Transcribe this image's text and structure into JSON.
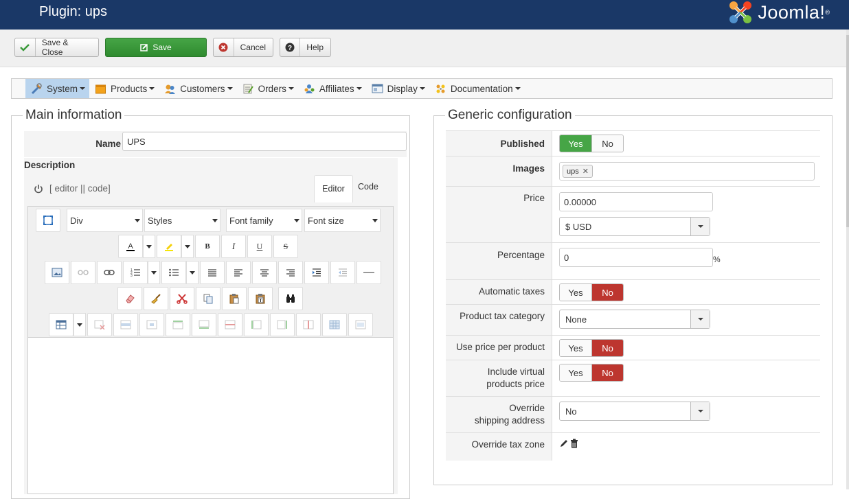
{
  "header": {
    "title": "Plugin: ups",
    "brand": "Joomla!",
    "brand_mark": "®"
  },
  "toolbar": {
    "save_close": "Save & Close",
    "save": "Save",
    "cancel": "Cancel",
    "help": "Help"
  },
  "menu": [
    {
      "label": "System",
      "icon": "tools-icon",
      "active": true
    },
    {
      "label": "Products",
      "icon": "box-icon"
    },
    {
      "label": "Customers",
      "icon": "users-icon"
    },
    {
      "label": "Orders",
      "icon": "orders-icon"
    },
    {
      "label": "Affiliates",
      "icon": "affiliates-icon"
    },
    {
      "label": "Display",
      "icon": "display-icon"
    },
    {
      "label": "Documentation",
      "icon": "documentation-icon"
    }
  ],
  "main": {
    "legend": "Main information",
    "name_label": "Name",
    "name_value": "UPS",
    "description_label": "Description",
    "editor_toggle": "[ editor || code]",
    "tab_editor": "Editor",
    "tab_code": "Code",
    "format_select": "Div",
    "styles_select": "Styles",
    "font_family_select": "Font family",
    "font_size_select": "Font size"
  },
  "generic": {
    "legend": "Generic configuration",
    "published_label": "Published",
    "published": "Yes",
    "images_label": "Images",
    "image_tag": "ups",
    "price_label": "Price",
    "price_value": "0.00000",
    "currency": "$ USD",
    "percentage_label": "Percentage",
    "percentage_value": "0",
    "percent_sign": "%",
    "auto_taxes_label": "Automatic taxes",
    "auto_taxes": "No",
    "tax_category_label": "Product tax category",
    "tax_category": "None",
    "price_per_product_label": "Use price per product",
    "price_per_product": "No",
    "virtual_label": "Include virtual products price",
    "virtual": "No",
    "override_shipping_label": "Override shipping address",
    "override_shipping": "No",
    "override_tax_label": "Override tax zone",
    "yes": "Yes",
    "no": "No"
  },
  "colors": {
    "header_bg": "#1a3867",
    "green": "#46a546",
    "red": "#bd362f",
    "active_menu": "#b9d4ee"
  }
}
